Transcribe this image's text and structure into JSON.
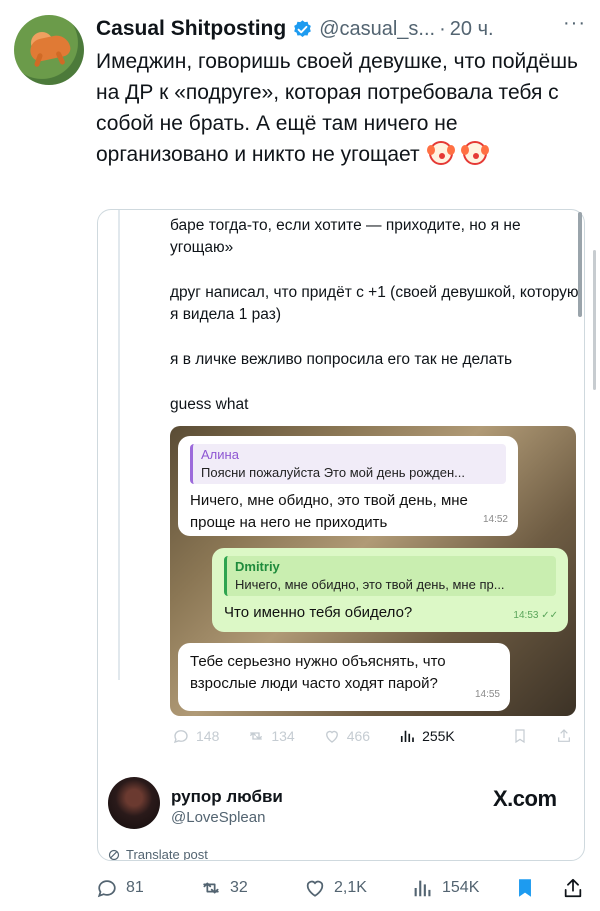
{
  "tweet": {
    "author_name": "Casual Shitposting",
    "author_handle": "@casual_s...",
    "separator": "·",
    "time": "20 ч.",
    "more_label": "···",
    "text": "Имеджин, говоришь своей девушке, что пойдёшь на ДР к «подруге», которая потребовала тебя с собой не брать. А ещё там ничего не организовано и никто не угощает",
    "emoji_icons": [
      "clown-face-icon",
      "clown-face-icon"
    ]
  },
  "embed": {
    "lines": [
      "баре тогда-то, если хотите — приходите, но я не угощаю»",
      "друг написал, что придёт с +1 (своей девушкой, которую я видела 1 раз)",
      "я в личке вежливо попросила его так не делать",
      "guess what"
    ],
    "chat": {
      "messages": [
        {
          "reply_name": "Алина",
          "reply_text": "Поясни пожалуйста Это мой день рожден...",
          "text": "Ничего, мне обидно, это твой день, мне проще на него не приходить",
          "time": "14:52"
        },
        {
          "reply_name": "Dmitriy",
          "reply_text": "Ничего, мне обидно, это твой день, мне пр...",
          "text": "Что именно тебя обидело?",
          "time": "14:53"
        },
        {
          "text": "Тебе серьезно нужно объяснять, что взрослые люди часто ходят парой?",
          "time": "14:55"
        }
      ]
    },
    "inner_actions": {
      "replies": "148",
      "retweets": "134",
      "likes": "466",
      "views": "255K"
    },
    "quoted_user": {
      "name": "рупор любви",
      "handle": "@LoveSplean",
      "source": "X.com"
    },
    "translate_label": "Translate post"
  },
  "actions": {
    "replies": "81",
    "retweets": "32",
    "likes": "2,1K",
    "views": "154K"
  },
  "colors": {
    "text": "#0f1419",
    "muted": "#536471",
    "verified": "#1d9bf0",
    "bookmark_active": "#1d9bf0",
    "chat_green": "#dcf8c6"
  }
}
